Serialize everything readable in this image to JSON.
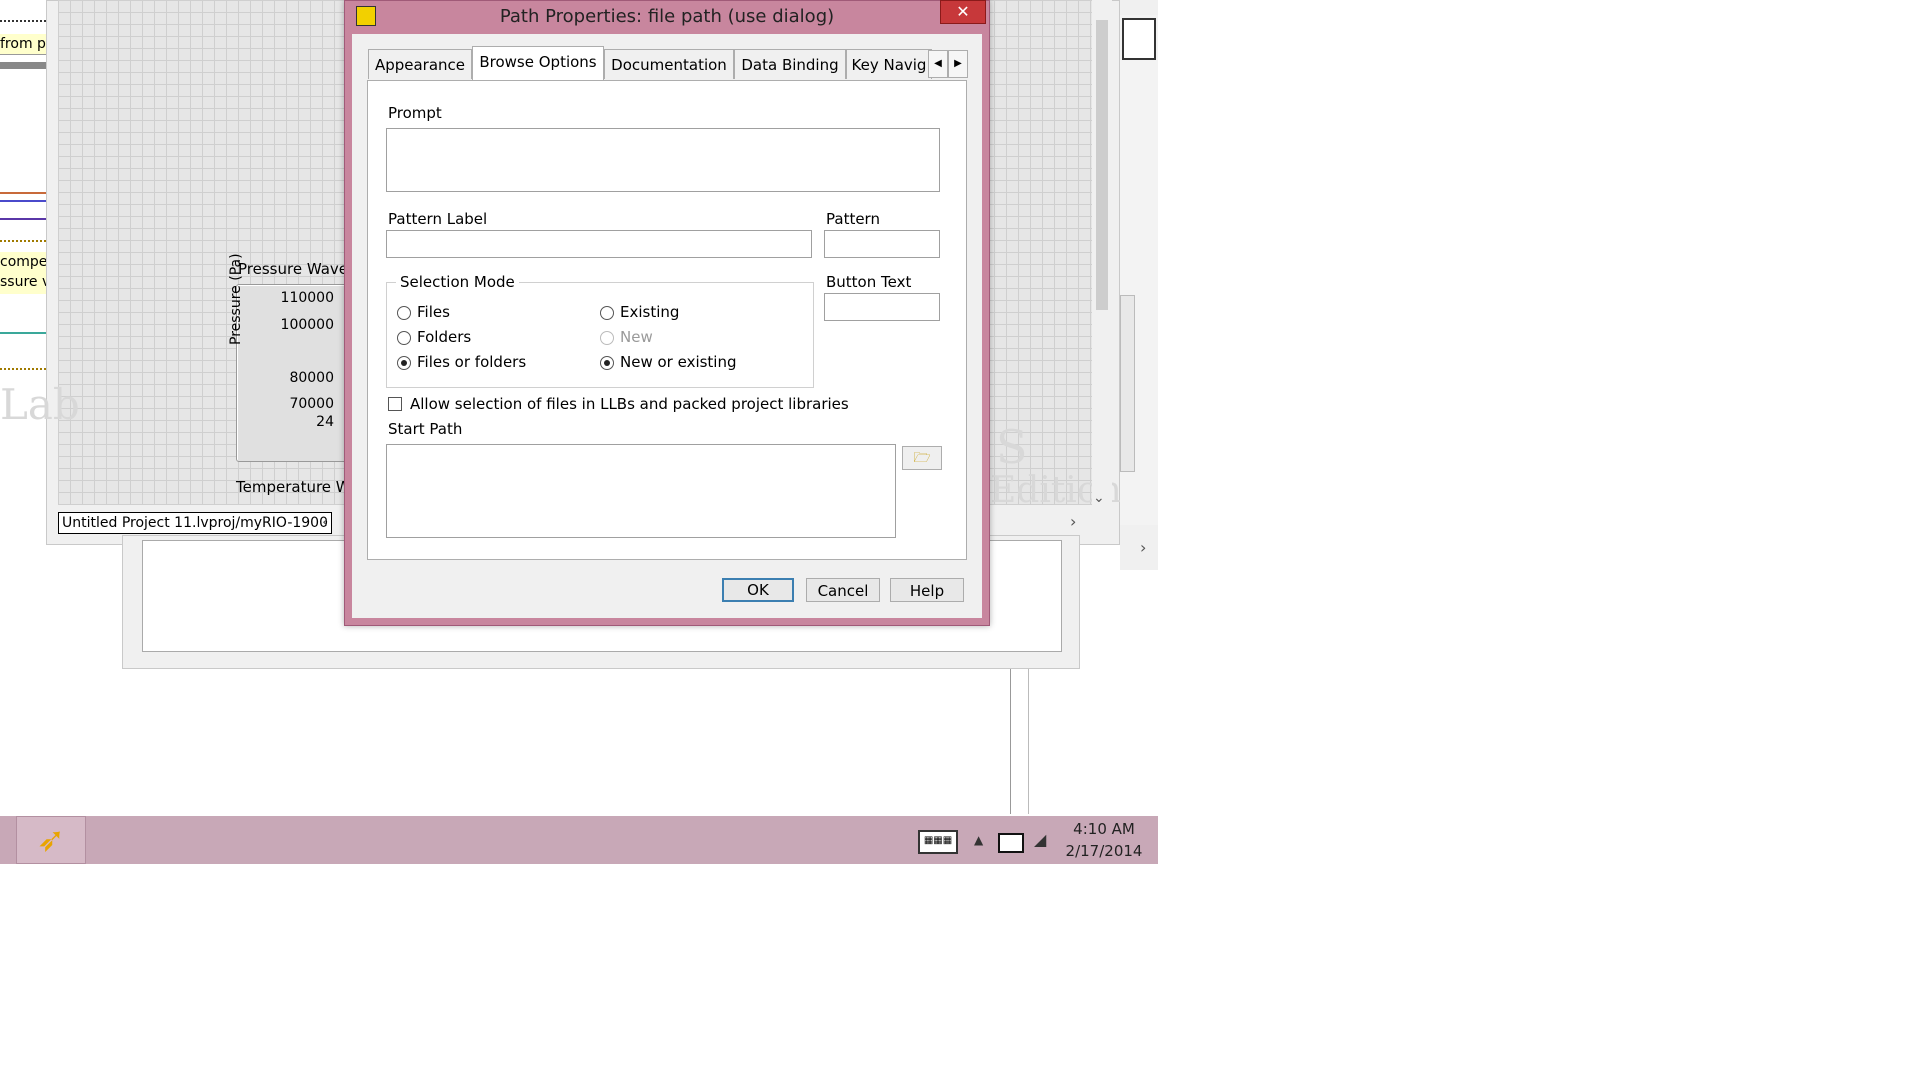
{
  "background": {
    "strip_from_text": "from p",
    "strip_compe_line1": "compe",
    "strip_compe_line2": "ssure va",
    "graph_title": "Pressure Wavefo",
    "graph_ylabel": "Pressure (Pa)",
    "graph_ticks": [
      "110000",
      "100000",
      "80000",
      "70000",
      "24"
    ],
    "temp_label": "Temperature Wa",
    "context_label": "Untitled Project 11.lvproj/myRIO-1900",
    "watermark_left": "Lab",
    "watermark_right": "Edition"
  },
  "dialog": {
    "title": "Path Properties: file path (use dialog)",
    "close_symbol": "✕",
    "tabs": [
      {
        "label": "Appearance"
      },
      {
        "label": "Browse Options"
      },
      {
        "label": "Documentation"
      },
      {
        "label": "Data Binding"
      },
      {
        "label": "Key Navig"
      }
    ],
    "active_tab": "Browse Options",
    "prompt_label": "Prompt",
    "prompt_value": "",
    "pattern_label_label": "Pattern Label",
    "pattern_label_value": "",
    "pattern_label": "Pattern",
    "pattern_value": "",
    "selection_mode_label": "Selection Mode",
    "radios": [
      {
        "label": "Files",
        "checked": false,
        "disabled": false
      },
      {
        "label": "Folders",
        "checked": false,
        "disabled": false
      },
      {
        "label": "Files or folders",
        "checked": true,
        "disabled": false
      },
      {
        "label": "Existing",
        "checked": false,
        "disabled": false
      },
      {
        "label": "New",
        "checked": false,
        "disabled": true
      },
      {
        "label": "New or existing",
        "checked": true,
        "disabled": false
      }
    ],
    "button_text_label": "Button Text",
    "button_text_value": "",
    "allow_llb_label": "Allow selection of files in LLBs and packed project libraries",
    "allow_llb_checked": false,
    "start_path_label": "Start Path",
    "start_path_value": "",
    "ok_label": "OK",
    "cancel_label": "Cancel",
    "help_label": "Help"
  },
  "taskbar": {
    "time": "4:10 AM",
    "date": "2/17/2014"
  },
  "colors": {
    "dialog_frame": "#c8869e",
    "taskbar": "#c8a8b7",
    "close_button": "#c7383a"
  }
}
